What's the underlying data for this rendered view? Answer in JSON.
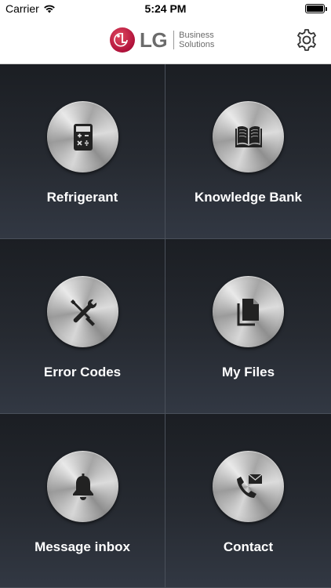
{
  "status_bar": {
    "carrier": "Carrier",
    "time": "5:24 PM",
    "wifi_icon": "wifi-icon",
    "battery_level": 1.0
  },
  "header": {
    "brand": "LG",
    "sub_line1": "Business",
    "sub_line2": "Solutions",
    "brand_color": "#a50034",
    "settings_icon": "gear-icon"
  },
  "tiles": [
    {
      "label": "Refrigerant",
      "icon": "calculator-icon"
    },
    {
      "label": "Knowledge Bank",
      "icon": "book-icon"
    },
    {
      "label": "Error Codes",
      "icon": "tools-icon"
    },
    {
      "label": "My Files",
      "icon": "files-icon"
    },
    {
      "label": "Message inbox",
      "icon": "bell-icon"
    },
    {
      "label": "Contact",
      "icon": "phone-mail-icon"
    }
  ]
}
